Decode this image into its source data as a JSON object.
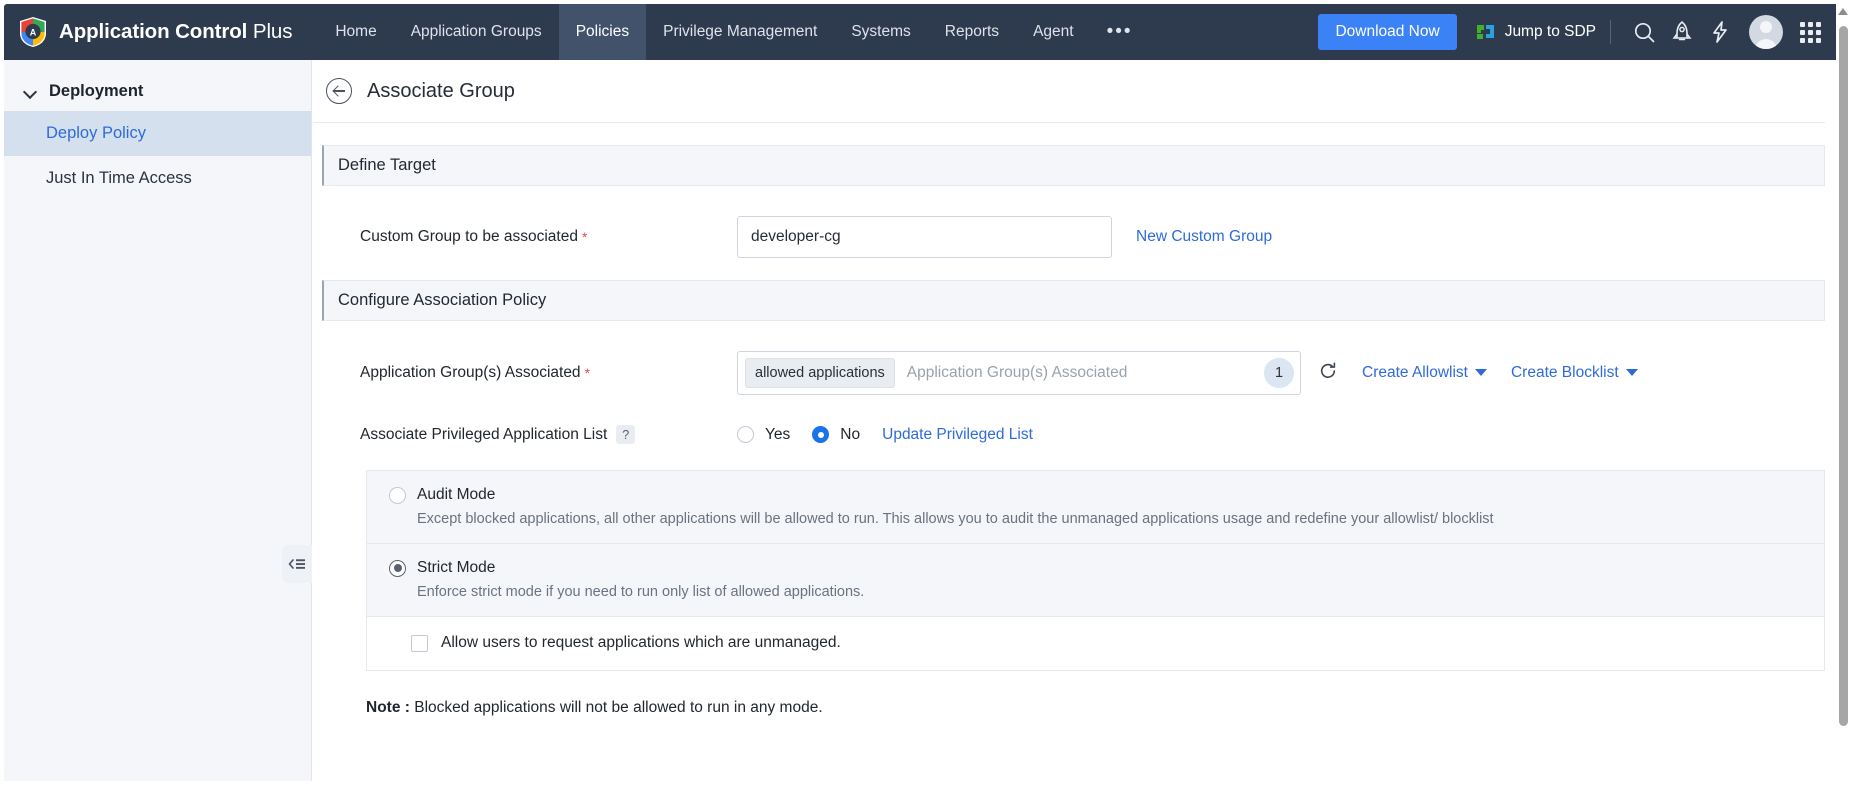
{
  "topbar": {
    "brand_bold": "Application Control",
    "brand_light": " Plus",
    "logo_icon": "shield-logo-icon",
    "nav": [
      {
        "label": "Home",
        "active": false
      },
      {
        "label": "Application Groups",
        "active": false
      },
      {
        "label": "Policies",
        "active": true
      },
      {
        "label": "Privilege Management",
        "active": false
      },
      {
        "label": "Systems",
        "active": false
      },
      {
        "label": "Reports",
        "active": false
      },
      {
        "label": "Agent",
        "active": false
      }
    ],
    "more_label": "•••",
    "download_label": "Download Now",
    "jump_label": "Jump to SDP",
    "icons": {
      "search": "search-icon",
      "rocket": "rocket-icon",
      "bolt": "bolt-icon",
      "avatar": "user-avatar",
      "apps": "app-grid-icon"
    },
    "accent_blue": "#3b82f6",
    "bar_bg": "#2e3a4d"
  },
  "sidebar": {
    "group_label": "Deployment",
    "items": [
      {
        "label": "Deploy Policy",
        "active": true
      },
      {
        "label": "Just In Time Access",
        "active": false
      }
    ],
    "collapse_icon": "collapse-sidebar-icon",
    "active_color": "#2f6bd8",
    "active_bg": "#d4e0ee"
  },
  "page": {
    "title": "Associate Group",
    "back_icon": "back-arrow-icon"
  },
  "define_target": {
    "section_title": "Define Target",
    "custom_group_label": "Custom Group to be associated",
    "required_mark": "*",
    "custom_group_value": "developer-cg",
    "custom_group_placeholder": "",
    "new_custom_group_link": "New Custom Group"
  },
  "association_policy": {
    "section_title": "Configure Association Policy",
    "app_group_label": "Application Group(s) Associated",
    "required_mark": "*",
    "app_group_tag": "allowed applications",
    "app_group_placeholder": "Application Group(s) Associated",
    "app_group_count": "1",
    "refresh_icon": "refresh-icon",
    "create_allowlist": "Create Allowlist",
    "create_blocklist": "Create Blocklist",
    "privileged_label": "Associate Privileged Application List",
    "help_icon_glyph": "?",
    "privileged_yes": "Yes",
    "privileged_no": "No",
    "privileged_selected": "No",
    "update_privileged_link": "Update Privileged List"
  },
  "modes": {
    "selected": "Strict Mode",
    "items": [
      {
        "title": "Audit Mode",
        "description": "Except blocked applications, all other applications will be allowed to run. This allows you to audit the unmanaged applications usage and redefine your allowlist/ blocklist",
        "selected": false
      },
      {
        "title": "Strict Mode",
        "description": "Enforce strict mode if you need to run only list of allowed applications.",
        "selected": true
      }
    ],
    "allow_request_label": "Allow users to request applications which are unmanaged.",
    "allow_request_checked": false
  },
  "note": {
    "prefix": "Note :",
    "text": " Blocked applications will not be allowed to run in any mode."
  }
}
